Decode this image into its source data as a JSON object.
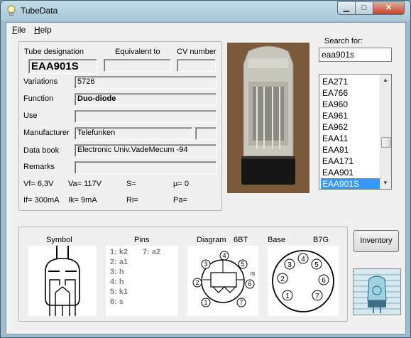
{
  "window": {
    "title": "TubeData",
    "min_glyph": "▁",
    "max_glyph": "□",
    "close_glyph": "✕"
  },
  "menu": {
    "file_key": "F",
    "file_rest": "ile",
    "help_key": "H",
    "help_rest": "elp"
  },
  "tube": {
    "designation_label": "Tube designation",
    "equivalent_label": "Equivalent to",
    "cv_label": "CV number",
    "designation": "EAA901S",
    "equivalent": "",
    "cv_number": "",
    "variations_label": "Variations",
    "variations": "5726",
    "function_label": "Function",
    "function": "Duo-diode",
    "use_label": "Use",
    "use": "",
    "manufacturer_label": "Manufacturer",
    "manufacturer": "Telefunken",
    "manufacturer_extra": "",
    "databook_label": "Data book",
    "databook": "Electronic Univ.VadeMecum -94",
    "remarks_label": "Remarks",
    "remarks": "",
    "vf": "Vf= 6,3V",
    "va": "Va=  117V",
    "s": "S=",
    "mu": "µ=    0",
    "if": "If= 300mA",
    "ik": "Ik=   9mA",
    "ri": "Ri=",
    "pa": "Pa="
  },
  "search": {
    "label": "Search for:",
    "value": "eaa901s",
    "results": [
      "EA271",
      "EA766",
      "EA960",
      "EA961",
      "EA962",
      "EAA11",
      "EAA91",
      "EAA171",
      "EAA901",
      "EAA901S"
    ],
    "selected_index": 9
  },
  "bottom": {
    "symbol_label": "Symbol",
    "pins_label": "Pins",
    "diagram_label": "Diagram",
    "diagram_code": "6BT",
    "base_label": "Base",
    "base_code": "B7G",
    "pins_col1": [
      "1: k2",
      "2: a1",
      "3: h",
      "4: h",
      "5: k1",
      "6: s"
    ],
    "pins_col2": [
      "7: a2"
    ],
    "diagram_pin_numbers": [
      "1",
      "2",
      "3",
      "4",
      "5",
      "6",
      "7"
    ],
    "diagram_extra": "IS",
    "base_pin_numbers": [
      "1",
      "2",
      "3",
      "4",
      "5",
      "6",
      "7"
    ]
  },
  "inventory_button": "Inventory",
  "colors": {
    "selection": "#3399ff",
    "titlebar": "#a8c8d8",
    "close": "#c7432a"
  }
}
